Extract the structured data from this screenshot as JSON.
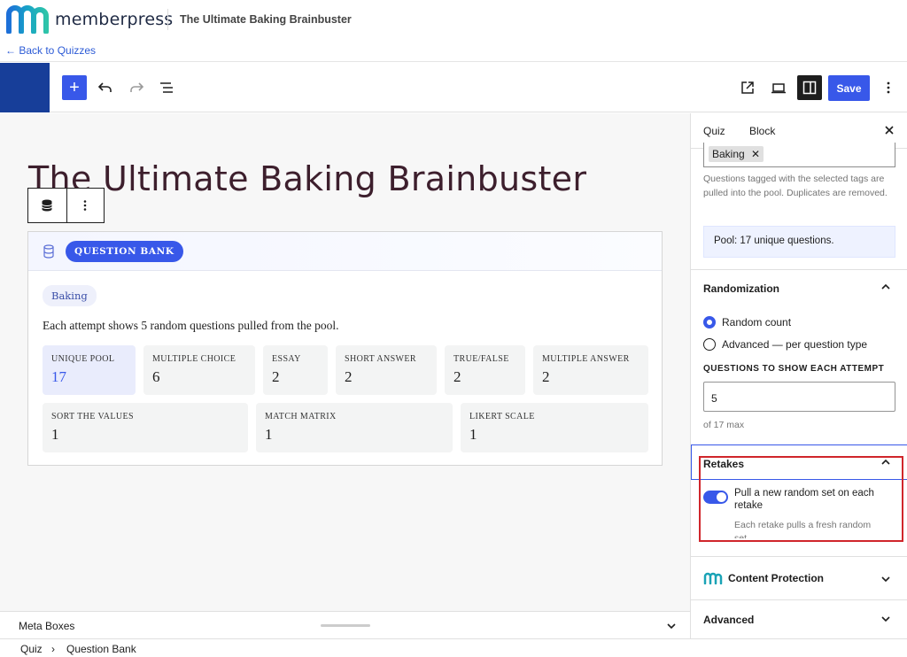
{
  "header": {
    "brand": "memberpress",
    "post_title": "The Ultimate Baking Brainbuster",
    "back_link": "← Back to Quizzes"
  },
  "toolbar": {
    "add_label": "+",
    "save_label": "Save"
  },
  "canvas": {
    "title": "The Ultimate Baking Brainbuster",
    "block_badge": "QUESTION BANK",
    "tag": "Baking",
    "description": "Each attempt shows 5 random questions pulled from the pool.",
    "stats_row1": [
      {
        "label": "UNIQUE POOL",
        "value": "17"
      },
      {
        "label": "MULTIPLE CHOICE",
        "value": "6"
      },
      {
        "label": "ESSAY",
        "value": "2"
      },
      {
        "label": "SHORT ANSWER",
        "value": "2"
      },
      {
        "label": "TRUE/FALSE",
        "value": "2"
      },
      {
        "label": "MULTIPLE ANSWER",
        "value": "2"
      }
    ],
    "stats_row2": [
      {
        "label": "SORT THE VALUES",
        "value": "1"
      },
      {
        "label": "MATCH MATRIX",
        "value": "1"
      },
      {
        "label": "LIKERT SCALE",
        "value": "1"
      }
    ]
  },
  "meta_boxes": {
    "label": "Meta Boxes"
  },
  "breadcrumb": {
    "items": [
      "Quiz",
      "Question Bank"
    ],
    "separator": "›"
  },
  "sidebar": {
    "tabs": [
      "Quiz",
      "Block"
    ],
    "active_tab": "Block",
    "tag_chip": "Baking",
    "tags_help": "Questions tagged with the selected tags are pulled into the pool. Duplicates are removed.",
    "pool_notice": "Pool: 17 unique questions.",
    "randomization": {
      "title": "Randomization",
      "options": [
        "Random count",
        "Advanced — per question type"
      ],
      "selected": "Random count",
      "field_label": "QUESTIONS TO SHOW EACH ATTEMPT",
      "field_value": "5",
      "field_help": "of 17 max"
    },
    "retakes": {
      "title": "Retakes",
      "toggle_label": "Pull a new random set on each retake",
      "toggle_on": true,
      "toggle_help": "Each retake pulls a fresh random set."
    },
    "content_protection": {
      "title": "Content Protection"
    },
    "advanced": {
      "title": "Advanced"
    }
  },
  "colors": {
    "accent": "#3858e9",
    "toolbar_blue": "#173e99",
    "title": "#3d1f2d",
    "highlight_red": "#d0262b"
  }
}
